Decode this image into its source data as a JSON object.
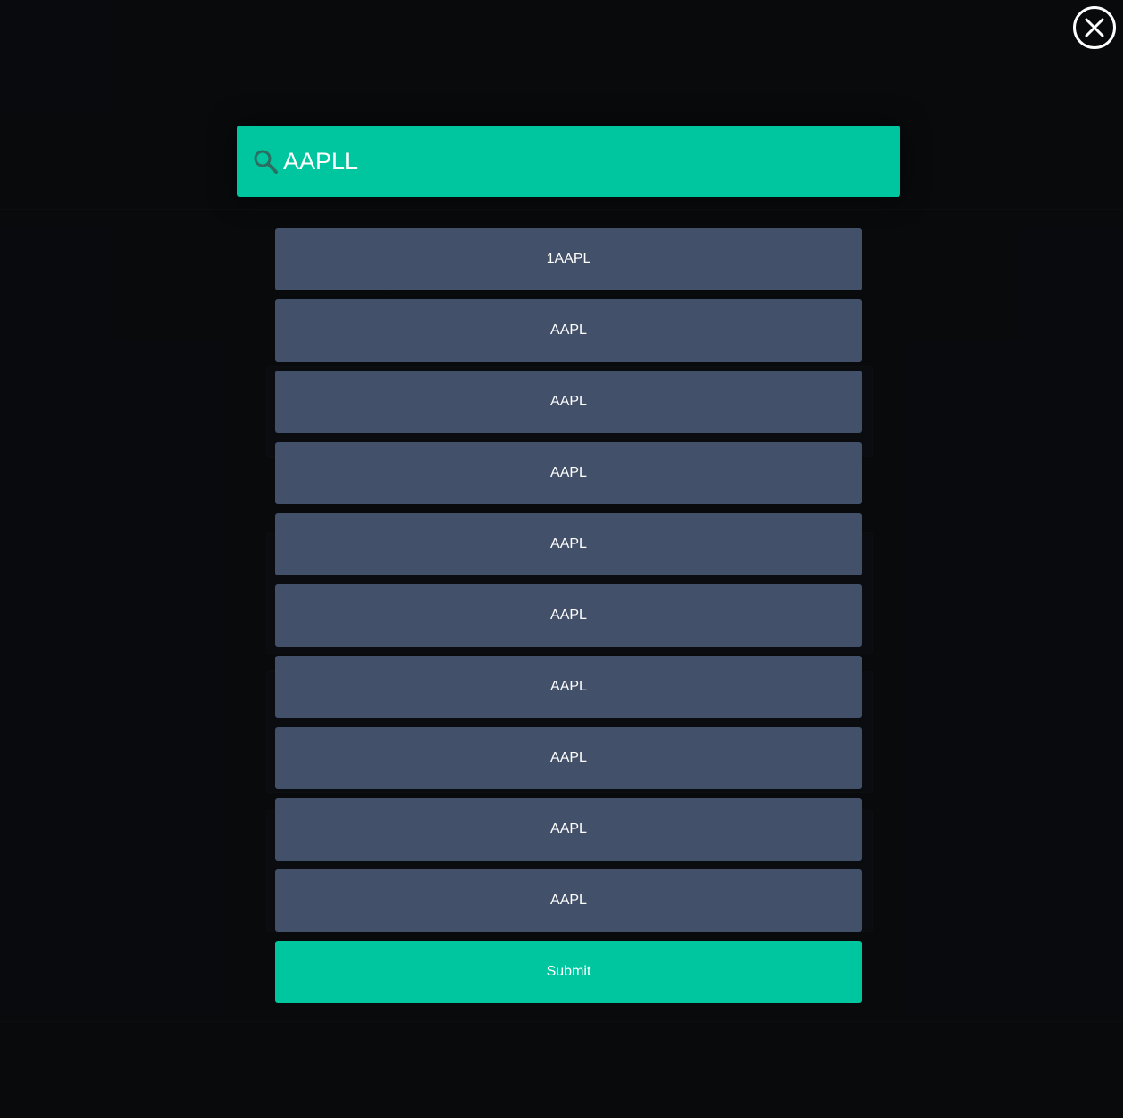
{
  "search": {
    "value": "AAPLL",
    "icon": "search-icon"
  },
  "close": {
    "icon": "close-icon"
  },
  "results": [
    {
      "label": "1AAPL"
    },
    {
      "label": "AAPL"
    },
    {
      "label": "AAPL"
    },
    {
      "label": "AAPL"
    },
    {
      "label": "AAPL"
    },
    {
      "label": "AAPL"
    },
    {
      "label": "AAPL"
    },
    {
      "label": "AAPL"
    },
    {
      "label": "AAPL"
    },
    {
      "label": "AAPL"
    }
  ],
  "submit": {
    "label": "Submit"
  },
  "colors": {
    "accent": "#00c6a0",
    "result_bg": "#435069",
    "background": "#0b0c0f"
  }
}
